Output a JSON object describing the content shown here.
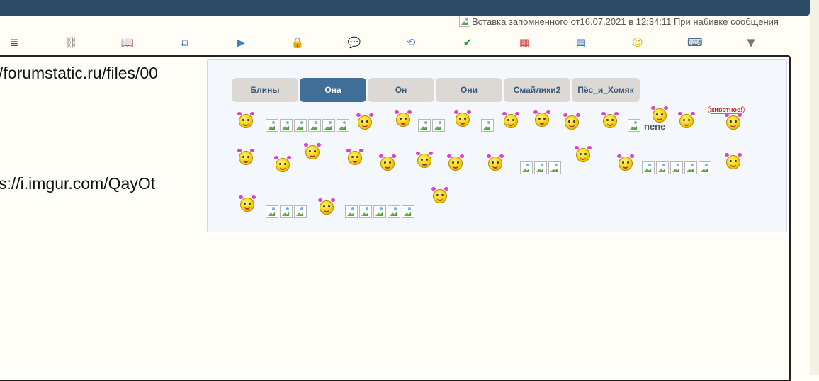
{
  "notice": {
    "text": "Вставка запомненного от16.07.2021 в 12:34:11 При набивке сообщения"
  },
  "toolbar": {
    "items": [
      {
        "icon": "align-icon",
        "glyph": "≣",
        "color": "#555555"
      },
      {
        "icon": "link-icon",
        "glyph": "⛓",
        "color": "#666666"
      },
      {
        "icon": "book-icon",
        "glyph": "📖",
        "color": "#3a6fb0"
      },
      {
        "icon": "copy-icon",
        "glyph": "⧉",
        "color": "#3a6fb0"
      },
      {
        "icon": "play-icon",
        "glyph": "▶",
        "color": "#3a80d0"
      },
      {
        "icon": "lock-icon",
        "glyph": "🔒",
        "color": "#d0a020"
      },
      {
        "icon": "speech-icon",
        "glyph": "💬",
        "color": "#3a80d0"
      },
      {
        "icon": "refresh-icon",
        "glyph": "⟲",
        "color": "#3a6fb0"
      },
      {
        "icon": "check-icon",
        "glyph": "✔",
        "color": "#1a9a30"
      },
      {
        "icon": "palette-icon",
        "glyph": "▦",
        "color": "#d04040"
      },
      {
        "icon": "table-icon",
        "glyph": "▤",
        "color": "#3a6fb0"
      },
      {
        "icon": "smiley-icon",
        "glyph": "☺",
        "color": "#e0b000"
      },
      {
        "icon": "keyboard-icon",
        "glyph": "⌨",
        "color": "#4a6a90"
      },
      {
        "icon": "dropdown-icon",
        "glyph": "▼",
        "color": "#777777"
      }
    ]
  },
  "editor": {
    "line1": "/forumstatic.ru/files/00",
    "line2": "s://i.imgur.com/QayOt"
  },
  "popup": {
    "tabs": [
      {
        "label": "Блины",
        "active": false
      },
      {
        "label": "Она",
        "active": true
      },
      {
        "label": "Он",
        "active": false
      },
      {
        "label": "Они",
        "active": false
      },
      {
        "label": "Смайлики2",
        "active": false
      },
      {
        "label": "Пёс_и_Хомяк",
        "active": false
      }
    ],
    "img_text": "nene",
    "tag_text": "животное!"
  }
}
